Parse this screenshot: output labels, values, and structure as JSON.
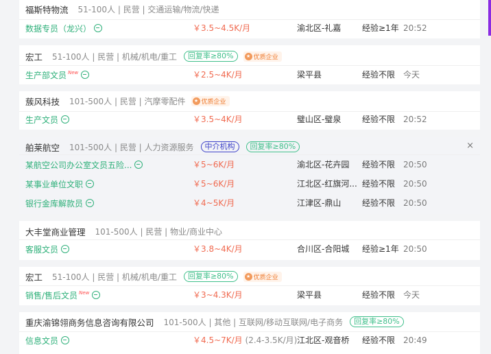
{
  "cards": [
    {
      "company": "福斯特物流",
      "meta": "51-100人 | 民营 | 交通运输/物流/快递",
      "tags": [],
      "quality": false,
      "jobs": [
        {
          "title": "数据专员（龙兴）",
          "isNew": false,
          "salary": "￥3.5~4.5K/月",
          "location": "渝北区-礼嘉",
          "experience": "经验≥1年",
          "time": "20:52"
        }
      ]
    },
    {
      "company": "宏工",
      "meta": "51-100人 | 民营 | 机械/机电/重工",
      "tags": [
        {
          "type": "rep",
          "label": "回复率≥80%"
        }
      ],
      "quality": true,
      "jobs": [
        {
          "title": "生产部文员",
          "isNew": true,
          "salary": "￥2.5~4K/月",
          "location": "梁平县",
          "experience": "经验不限",
          "time": "今天"
        }
      ]
    },
    {
      "company": "蔟风科技",
      "meta": "101-500人 | 民营 | 汽摩零配件",
      "tags": [],
      "quality": true,
      "jobs": [
        {
          "title": "生产文员",
          "isNew": false,
          "salary": "￥3.5~4K/月",
          "location": "璧山区-璧泉",
          "experience": "经验不限",
          "time": "20:52"
        }
      ]
    },
    {
      "company": "舶莱航空",
      "meta": "101-500人 | 民营 | 人力资源服务",
      "tags": [
        {
          "type": "agency",
          "label": "中介机构"
        },
        {
          "type": "rep",
          "label": "回复率≥80%"
        }
      ],
      "quality": false,
      "closable": true,
      "jobs": [
        {
          "title": "某航空公司办公室文员五险...",
          "isNew": false,
          "salary": "￥5~6K/月",
          "location": "渝北区-花卉园",
          "experience": "经验不限",
          "time": "20:50"
        },
        {
          "title": "某事业单位文职",
          "isNew": false,
          "salary": "￥5~6K/月",
          "location": "江北区-红旗河...",
          "experience": "经验不限",
          "time": "20:50"
        },
        {
          "title": "银行金库解款员",
          "isNew": false,
          "salary": "￥4~5K/月",
          "location": "江津区-鼎山",
          "experience": "经验不限",
          "time": "20:50"
        }
      ]
    },
    {
      "company": "大丰堂商业管理",
      "meta": "101-500人 | 民营 | 物业/商业中心",
      "tags": [],
      "quality": false,
      "jobs": [
        {
          "title": "客服文员",
          "isNew": false,
          "salary": "￥3.8~4K/月",
          "location": "合川区-合阳城",
          "experience": "经验≥1年",
          "time": "20:50"
        }
      ]
    },
    {
      "company": "宏工",
      "meta": "51-100人 | 民营 | 机械/机电/重工",
      "tags": [
        {
          "type": "rep",
          "label": "回复率≥80%"
        }
      ],
      "quality": true,
      "jobs": [
        {
          "title": "销售/售后文员",
          "isNew": true,
          "salary": "￥3~4.3K/月",
          "location": "梁平县",
          "experience": "经验不限",
          "time": "今天"
        }
      ]
    },
    {
      "company": "重庆渝锦翎商务信息咨询有限公司",
      "meta": "101-500人 | 其他 | 互联网/移动互联网/电子商务",
      "tags": [
        {
          "type": "rep",
          "label": "回复率≥80%"
        }
      ],
      "quality": false,
      "jobs": [
        {
          "title": "信息文员",
          "isNew": false,
          "salary": "￥4.5~7K/月",
          "salarySub": "(2.4-3.5K/月)",
          "location": "江北区-观音桥",
          "experience": "经验不限",
          "time": "20:49"
        }
      ]
    }
  ],
  "labels": {
    "quality": "优质企业",
    "qualityIcon": "★",
    "newBadge": "New",
    "close": "×"
  },
  "icons": {
    "chat": "chat-bubble-icon",
    "quality": "badge-icon",
    "close": "close-icon"
  },
  "colors": {
    "jobTitle": "#2fb07a",
    "salary": "#f06a50",
    "replyTag": "#3fbf8a",
    "agencyTag": "#3a3fc8",
    "quality": "#ee7a2d",
    "scrollbar": "#8a2be2"
  }
}
